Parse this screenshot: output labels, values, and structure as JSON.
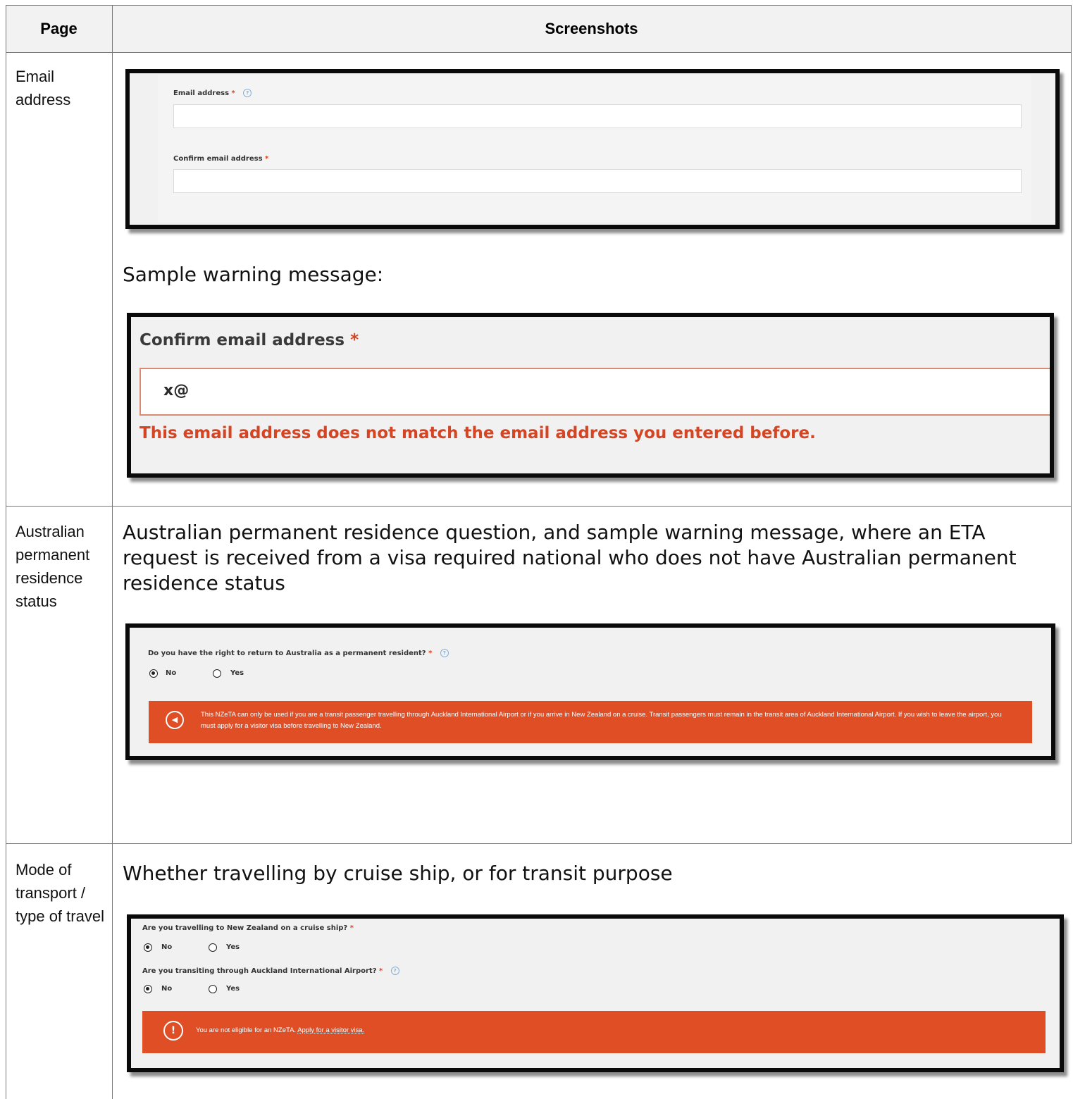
{
  "header": {
    "page": "Page",
    "screenshots": "Screenshots"
  },
  "rows": {
    "email": {
      "page_label": "Email address",
      "frame": {
        "email_label": "Email address",
        "confirm_label": "Confirm email address",
        "required_mark": "*"
      },
      "warning_caption": "Sample warning message:",
      "warning": {
        "label": "Confirm email address",
        "required_mark": "*",
        "value": "x@",
        "error": "This email address does not match the email address you entered before."
      }
    },
    "australia": {
      "page_label": "Australian permanent residence status",
      "caption": "Australian permanent residence question, and sample warning message, where an ETA request is received from a visa required national who does not have Australian permanent residence status",
      "question": "Do you have the right to return to Australia as a permanent resident?",
      "required_mark": "*",
      "options": {
        "no": "No",
        "yes": "Yes"
      },
      "selected": "No",
      "banner": "This NZeTA can only be used if you are a transit passenger travelling through Auckland International Airport or if you arrive in New Zealand on a cruise. Transit passengers must remain in the transit area of Auckland International Airport. If you wish to leave the airport, you must apply for a visitor visa before travelling to New Zealand."
    },
    "transport": {
      "page_label": "Mode of transport / type of travel",
      "caption": "Whether travelling by cruise ship, or for transit purpose",
      "q1": "Are you travelling to New Zealand on a cruise ship?",
      "q2": "Are you transiting through Auckland International Airport?",
      "required_mark": "*",
      "options": {
        "no": "No",
        "yes": "Yes"
      },
      "q1_selected": "No",
      "q2_selected": "No",
      "banner_text": "You are not eligible for an NZeTA.",
      "banner_link": "Apply for a visitor visa."
    }
  },
  "colors": {
    "error": "#d64523",
    "banner": "#e04e26",
    "help": "#86b0da"
  }
}
